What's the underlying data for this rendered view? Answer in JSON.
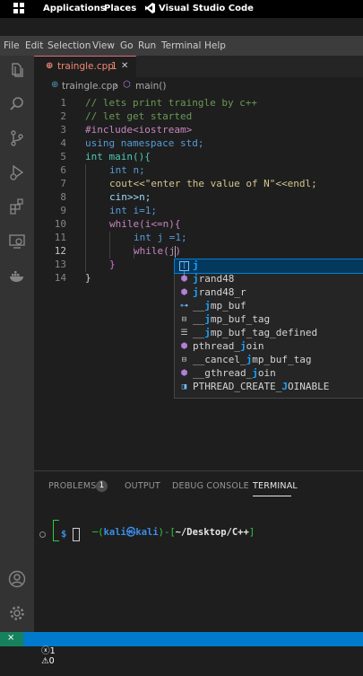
{
  "system_bar": {
    "applications": "Applications",
    "places": "Places",
    "app_name": "Visual Studio Code"
  },
  "menu": [
    "File",
    "Edit",
    "Selection",
    "View",
    "Go",
    "Run",
    "Terminal",
    "Help"
  ],
  "tab": {
    "filename": "traingle.cpp",
    "problems": "1",
    "close": "✕"
  },
  "breadcrumb": {
    "file": "traingle.cpp",
    "separator": "›",
    "symbol": "main()"
  },
  "editor": {
    "line_numbers": [
      "1",
      "2",
      "3",
      "4",
      "5",
      "6",
      "7",
      "8",
      "9",
      "10",
      "11",
      "12",
      "13",
      "14"
    ],
    "lines": [
      "// lets print traingle by c++",
      "// let get started",
      "#include<iostream>",
      "using namespace std;",
      "int main(){",
      "int n;",
      "cout<<\"enter the value of N\"<<endl;",
      "cin>>n;",
      "int i=1;",
      "while(i<=n){",
      "int j =1;",
      "while(j)",
      "}",
      "}"
    ]
  },
  "suggestions": [
    {
      "kind": "variable",
      "pre": "",
      "match": "j",
      "post": ""
    },
    {
      "kind": "method",
      "pre": "",
      "match": "j",
      "post": "rand48"
    },
    {
      "kind": "method",
      "pre": "",
      "match": "j",
      "post": "rand48_r"
    },
    {
      "kind": "typedef",
      "pre": "__",
      "match": "j",
      "post": "mp_buf"
    },
    {
      "kind": "struct",
      "pre": "__",
      "match": "j",
      "post": "mp_buf_tag"
    },
    {
      "kind": "macro",
      "pre": "__",
      "match": "j",
      "post": "mp_buf_tag_defined"
    },
    {
      "kind": "method",
      "pre": "pthread_",
      "match": "j",
      "post": "oin"
    },
    {
      "kind": "struct",
      "pre": "__cancel_",
      "match": "j",
      "post": "mp_buf_tag"
    },
    {
      "kind": "method",
      "pre": "__gthread_",
      "match": "j",
      "post": "oin"
    },
    {
      "kind": "enum",
      "pre": "PTHREAD_CREATE_",
      "match": "J",
      "post": "OINABLE"
    }
  ],
  "panel": {
    "tabs": [
      "PROBLEMS",
      "OUTPUT",
      "DEBUG CONSOLE",
      "TERMINAL"
    ],
    "problems_badge": "1",
    "terminal_user": "kali㉿kali",
    "terminal_path": "~/Desktop/C++",
    "prompt": "$"
  },
  "status": {
    "errors": "1",
    "warnings": "0"
  },
  "colors": {
    "status_bar": "#007acc",
    "remote_button": "#16825d",
    "tab_error": "#f48771",
    "terminal_green": "#2ecc40",
    "terminal_blue": "#3b8eea"
  }
}
